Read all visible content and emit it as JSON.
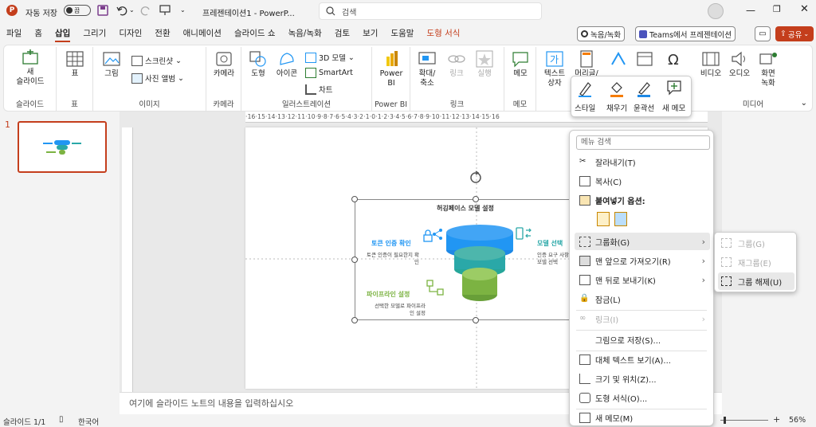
{
  "titlebar": {
    "autosave_label": "자동 저장",
    "autosave_state": "끔",
    "doc_title": "프레젠테이션1  -  PowerP...",
    "search_placeholder": "검색"
  },
  "menus": [
    "파일",
    "홈",
    "삽입",
    "그리기",
    "디자인",
    "전환",
    "애니메이션",
    "슬라이드 쇼",
    "녹음/녹화",
    "검토",
    "보기",
    "도움말",
    "도형 서식"
  ],
  "menu_right": {
    "record": "녹음/녹화",
    "teams": "Teams에서 프레젠테이션",
    "share": "공유"
  },
  "ribbon": {
    "new_slide": "새\n슬라이드",
    "table": "표",
    "image": "그림",
    "screenshot": "스크린샷",
    "photo_album": "사진 앨범",
    "camera": "카메라",
    "shape": "도형",
    "icon": "아이콘",
    "model3d": "3D 모델",
    "smartart": "SmartArt",
    "chart": "차트",
    "powerbi": "Power\nBI",
    "zoom": "확대/\n축소",
    "link": "링크",
    "action": "실행",
    "memo": "메모",
    "textbox": "텍스트\n상자",
    "header": "머리글/",
    "wordart": "WordArt",
    "symbol": "기호",
    "video": "비디오",
    "audio": "오디오",
    "screen_record": "화면\n녹화",
    "groups": {
      "slides": "슬라이드",
      "table": "표",
      "image": "이미지",
      "camera": "카메라",
      "illustration": "일러스트레이션",
      "powerbi": "Power BI",
      "link": "링크",
      "memo": "메모",
      "media": "미디어"
    }
  },
  "floating_toolbar": {
    "style": "스타일",
    "fill": "채우기",
    "outline": "윤곽선",
    "new_memo": "새 메모"
  },
  "hruler_text": "·16·15·14·13·12·11·10·9·8·7·6·5·4·3·2·1·0·1·2·3·4·5·6·7·8·9·10·11·12·13·14·15·16",
  "slide": {
    "title": "허깅페이스 모델 설정",
    "token_title": "토큰 인증 확인",
    "token_desc": "토큰 인증이 필요한지 확\n인",
    "model_title": "모델 선택",
    "model_desc": "인증 요구 사항\n모델 선택",
    "pipeline_title": "파이프라인 설정",
    "pipeline_desc": "선택한 모델로 파이프라\n인 설정"
  },
  "slide_number": "1",
  "context_menu": {
    "search_placeholder": "메뉴 검색",
    "cut": "잘라내기(T)",
    "copy": "복사(C)",
    "paste_options": "붙여넣기 옵션:",
    "group": "그룹화(G)",
    "bring_front": "맨 앞으로 가져오기(R)",
    "send_back": "맨 뒤로 보내기(K)",
    "lock": "잠금(L)",
    "link": "링크(I)",
    "save_as_picture": "그림으로 저장(S)...",
    "alt_text": "대체 텍스트 보기(A)...",
    "size_position": "크기 및 위치(Z)...",
    "format_shape": "도형 서식(O)...",
    "new_memo": "새 메모(M)"
  },
  "submenu": {
    "group": "그룹(G)",
    "regroup": "재그룹(E)",
    "ungroup": "그룹 해제(U)"
  },
  "notes_placeholder": "여기에 슬라이드 노트의 내용을 입력하십시오",
  "status": {
    "slide": "슬라이드 1/1",
    "language": "한국어",
    "zoom": "56%"
  },
  "colors": {
    "accent": "#c43e1c",
    "teal": "#2aa8a8",
    "blue": "#2196f3",
    "green": "#7cb342"
  }
}
